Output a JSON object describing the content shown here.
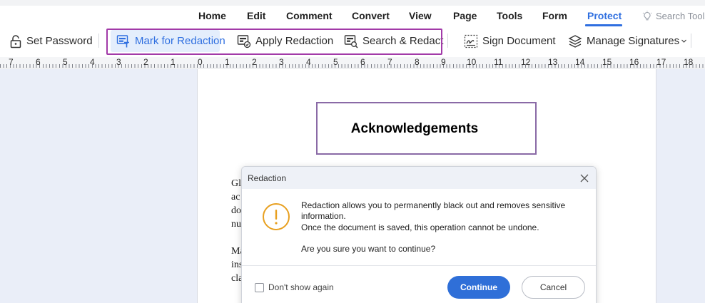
{
  "menu": {
    "items": [
      {
        "label": "Home"
      },
      {
        "label": "Edit"
      },
      {
        "label": "Comment"
      },
      {
        "label": "Convert"
      },
      {
        "label": "View"
      },
      {
        "label": "Page"
      },
      {
        "label": "Tools"
      },
      {
        "label": "Form"
      },
      {
        "label": "Protect",
        "active": true
      }
    ],
    "search_tools": "Search Tools"
  },
  "toolbar": {
    "set_password": "Set Password",
    "mark_for_redaction": "Mark for Redaction",
    "apply_redaction": "Apply Redaction",
    "search_redact": "Search & Redact",
    "sign_document": "Sign Document",
    "manage_signatures": "Manage Signatures"
  },
  "ruler": {
    "labels": [
      "7",
      "6",
      "5",
      "4",
      "3",
      "2",
      "1",
      "0",
      "1",
      "2",
      "3",
      "4",
      "5",
      "6",
      "7",
      "8",
      "9",
      "10",
      "11",
      "12",
      "13",
      "14",
      "15",
      "16",
      "17",
      "18"
    ]
  },
  "document": {
    "heading": "Acknowledgements",
    "fragments": [
      "Gl",
      "ac",
      "do",
      "nu",
      "Ma",
      "ins",
      "cla"
    ]
  },
  "dialog": {
    "title": "Redaction",
    "line1": "Redaction allows you to permanently black out and removes sensitive",
    "line2": "information.",
    "line3": "Once the document is saved, this operation cannot be undone.",
    "line4": "Are you sure you want to continue?",
    "dont_show": "Don't show again",
    "continue": "Continue",
    "cancel": "Cancel"
  },
  "colors": {
    "accent": "#2f6fe0",
    "highlight_frame": "#a23aa8",
    "warning": "#e8a020",
    "workspace": "#eaeef8"
  }
}
